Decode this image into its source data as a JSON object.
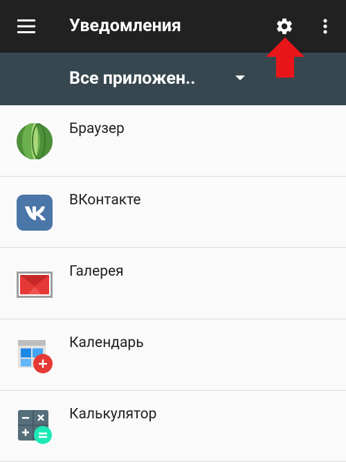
{
  "app_bar": {
    "title": "Уведомления",
    "menu_icon": "hamburger-menu-icon",
    "settings_icon": "gear-icon",
    "more_icon": "more-vert-icon",
    "background": "#212121"
  },
  "filter": {
    "selected": "Все приложен..",
    "background": "#37474f"
  },
  "annotation": {
    "icon": "red-arrow-up-icon",
    "color": "#e8161b"
  },
  "apps": [
    {
      "name": "Браузер",
      "icon": "browser-icon"
    },
    {
      "name": "ВКонтакте",
      "icon": "vk-icon"
    },
    {
      "name": "Галерея",
      "icon": "gallery-icon"
    },
    {
      "name": "Календарь",
      "icon": "calendar-icon"
    },
    {
      "name": "Калькулятор",
      "icon": "calculator-icon"
    }
  ]
}
